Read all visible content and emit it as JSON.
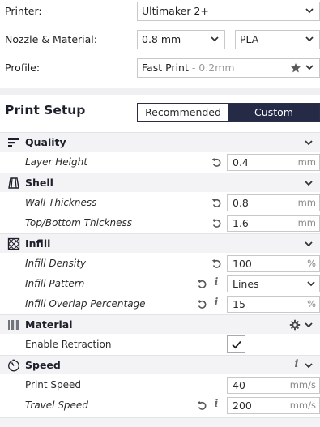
{
  "printer": {
    "label": "Printer:",
    "value": "Ultimaker 2+"
  },
  "nozzle_material": {
    "label": "Nozzle & Material:",
    "nozzle": "0.8 mm",
    "material": "PLA"
  },
  "profile": {
    "label": "Profile:",
    "name": "Fast Print",
    "detail": " - 0.2mm"
  },
  "print_setup": {
    "title": "Print Setup",
    "tabs": [
      "Recommended",
      "Custom"
    ],
    "active_tab": "Custom"
  },
  "sections": {
    "quality": {
      "name": "Quality",
      "layer_height": {
        "label": "Layer Height",
        "value": "0.4",
        "unit": "mm"
      }
    },
    "shell": {
      "name": "Shell",
      "wall_thickness": {
        "label": "Wall Thickness",
        "value": "0.8",
        "unit": "mm"
      },
      "top_bottom_thickness": {
        "label": "Top/Bottom Thickness",
        "value": "1.6",
        "unit": "mm"
      }
    },
    "infill": {
      "name": "Infill",
      "density": {
        "label": "Infill Density",
        "value": "100",
        "unit": "%"
      },
      "pattern": {
        "label": "Infill Pattern",
        "value": "Lines"
      },
      "overlap": {
        "label": "Infill Overlap Percentage",
        "value": "15",
        "unit": "%"
      }
    },
    "material": {
      "name": "Material",
      "enable_retraction": {
        "label": "Enable Retraction",
        "checked": true
      }
    },
    "speed": {
      "name": "Speed",
      "print_speed": {
        "label": "Print Speed",
        "value": "40",
        "unit": "mm/s"
      },
      "travel_speed": {
        "label": "Travel Speed",
        "value": "200",
        "unit": "mm/s"
      }
    }
  },
  "icons": {
    "info": "i"
  }
}
